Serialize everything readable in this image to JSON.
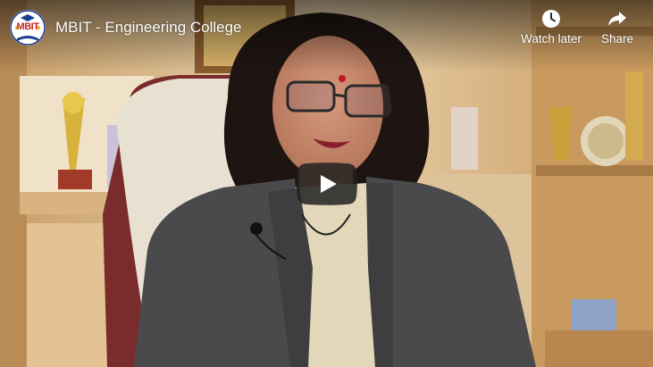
{
  "video": {
    "title": "MBIT - Engineering College",
    "channel_logo_text": "MBIT"
  },
  "actions": {
    "watch_later": {
      "label": "Watch later",
      "icon": "clock-icon"
    },
    "share": {
      "label": "Share",
      "icon": "share-arrow-icon"
    }
  },
  "controls": {
    "play": {
      "icon": "play-icon"
    }
  },
  "colors": {
    "play_bg": "#212121",
    "overlay_text": "#ffffff",
    "logo_red": "#c62828",
    "logo_blue": "#1a3d8f"
  }
}
